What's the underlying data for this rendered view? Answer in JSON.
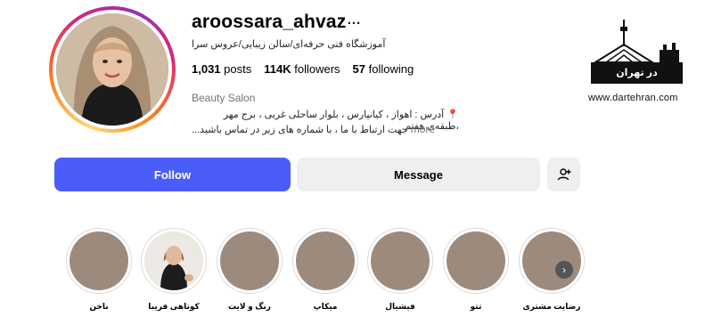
{
  "profile": {
    "username": "aroossara_ahvaz",
    "more_icon": "…",
    "bio_title": "آموزشگاه فنی حرفه‌ای/سالن زیبایی/عروس سرا",
    "stats": {
      "posts_count": "1,031",
      "posts_label": "posts",
      "followers_count": "114K",
      "followers_label": "followers",
      "following_count": "57",
      "following_label": "following"
    },
    "category": "Beauty Salon",
    "address_line1": "📍 آدرس : اهواز ، کیانپارس ، بلوار ساحلی غربی ، برج مهر ،طبقه‌ی هفتم",
    "address_line2": "جهت ارتباط با ما ، با شماره های زیر در تماس باشید...",
    "more_link": "more"
  },
  "logo": {
    "brand_text": "در تهران",
    "url": "www.dartehran.com"
  },
  "actions": {
    "follow_label": "Follow",
    "message_label": "Message",
    "add_user_icon": "add-user-icon"
  },
  "highlights": [
    {
      "label": "رضایت مشتری"
    },
    {
      "label": "تتو"
    },
    {
      "label": "فیشیال"
    },
    {
      "label": "میکاپ"
    },
    {
      "label": "رنگ و لایت"
    },
    {
      "label": "کوتاهی فریبا"
    },
    {
      "label": "ناخن"
    }
  ],
  "colors": {
    "follow_button": "#4a5df9",
    "secondary_button": "#efefef",
    "highlight_placeholder": "#9c8b7d"
  }
}
